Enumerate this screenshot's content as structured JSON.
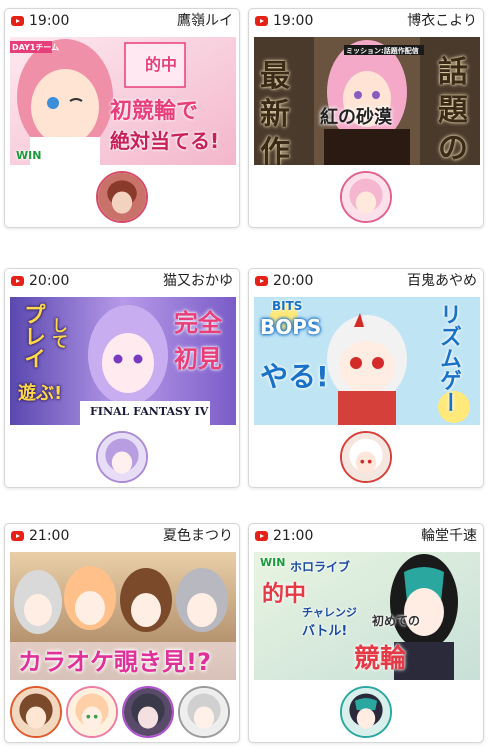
{
  "streams": [
    {
      "time": "19:00",
      "streamer": "鷹嶺ルイ",
      "thumb_texts": [
        "DAY1チーム",
        "的中",
        "初競輪で",
        "絶対当てる!",
        "WIN"
      ],
      "colors": {
        "bg": "#f7c7d7",
        "accent": "#e83e7a",
        "hair": "#f08fa8"
      },
      "avatars": [
        {
          "name": "collab-avatar",
          "border": "#d64b6a",
          "tone": "#8a3a2a"
        }
      ]
    },
    {
      "time": "19:00",
      "streamer": "博衣こより",
      "thumb_texts": [
        "最",
        "新",
        "作",
        "話",
        "題",
        "の",
        "紅の砂漠",
        "ミッション:話題作配信"
      ],
      "colors": {
        "bg": "#5a4a3a",
        "accent": "#3a2a1a",
        "hair": "#f5a9c8"
      },
      "avatars": [
        {
          "name": "koyori-avatar",
          "border": "#e35f8f",
          "tone": "#f5b7cf"
        }
      ]
    },
    {
      "time": "20:00",
      "streamer": "猫又おかゆ",
      "thumb_texts": [
        "プレイ",
        "して",
        "遊ぶ!",
        "完全",
        "初見",
        "FINAL FANTASY IV"
      ],
      "colors": {
        "bg": "#9b7ad9",
        "accent": "#ffd84a",
        "hair": "#b79ae8"
      },
      "avatars": [
        {
          "name": "okayu-avatar",
          "border": "#a98bd6",
          "tone": "#b89ee0"
        }
      ]
    },
    {
      "time": "20:00",
      "streamer": "百鬼あやめ",
      "thumb_texts": [
        "BITS",
        "BOPS",
        "やる!",
        "リズムゲー"
      ],
      "colors": {
        "bg": "#bfe4f4",
        "accent": "#1a72c8",
        "hair": "#f2f2f2"
      },
      "avatars": [
        {
          "name": "ayame-avatar",
          "border": "#d5413a",
          "tone": "#ffffff"
        }
      ]
    },
    {
      "time": "21:00",
      "streamer": "夏色まつり",
      "thumb_texts": [
        "カラオケ覗き見!?"
      ],
      "colors": {
        "bg": "#c8a27a",
        "accent": "#e0319a",
        "hair": "#d9d9d9"
      },
      "avatars": [
        {
          "name": "collab-avatar-1",
          "border": "#e05a2b",
          "tone": "#7a4a2a"
        },
        {
          "name": "collab-avatar-2",
          "border": "#f07ca0",
          "tone": "#ffcfa8"
        },
        {
          "name": "collab-avatar-3",
          "border": "#b04fd0",
          "tone": "#3a3a4a"
        },
        {
          "name": "collab-avatar-4",
          "border": "#9b9b9b",
          "tone": "#d0d0d0"
        }
      ]
    },
    {
      "time": "21:00",
      "streamer": "輪堂千速",
      "thumb_texts": [
        "ホロライブ",
        "的中",
        "チャレンジ",
        "バトル!",
        "初めての",
        "競輪",
        "WIN"
      ],
      "colors": {
        "bg": "#d8ecd0",
        "accent": "#e63946",
        "hair": "#1a1a1a"
      },
      "avatars": [
        {
          "name": "chihaya-avatar",
          "border": "#2aa8a0",
          "tone": "#2a2a3a"
        }
      ]
    }
  ]
}
